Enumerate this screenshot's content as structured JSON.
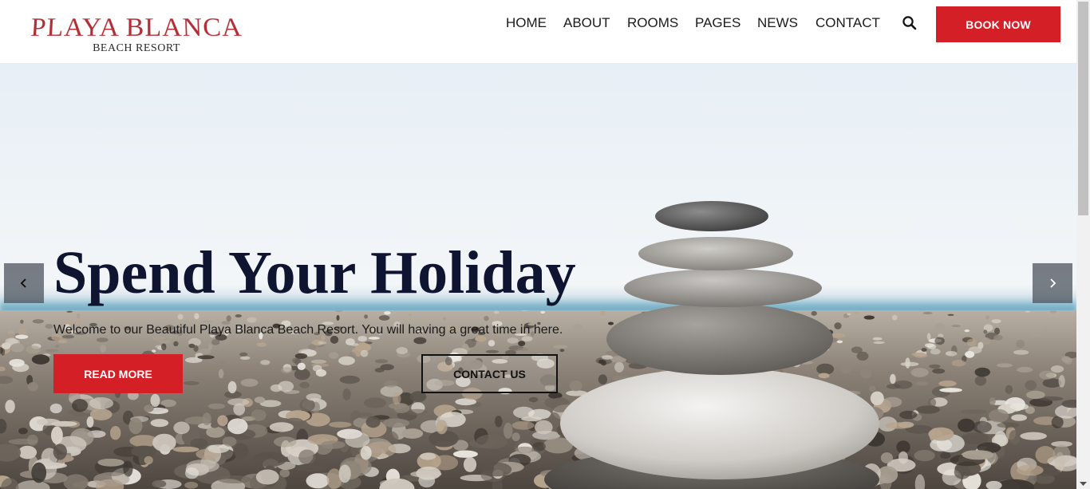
{
  "brand": {
    "name": "PLAYA BLANCA",
    "tagline": "BEACH RESORT",
    "color": "#b32d35"
  },
  "nav": {
    "items": [
      {
        "label": "HOME"
      },
      {
        "label": "ABOUT"
      },
      {
        "label": "ROOMS"
      },
      {
        "label": "PAGES"
      },
      {
        "label": "NEWS"
      },
      {
        "label": "CONTACT"
      }
    ],
    "search_icon": "search-icon",
    "book_label": "BOOK NOW"
  },
  "hero": {
    "title": "Spend Your Holiday",
    "text": "Welcome to our Beautiful Playa Blanca Beach Resort. You will having a great time in here.",
    "read_more_label": "READ MORE",
    "contact_label": "CONTACT US",
    "prev_icon": "chevron-left-icon",
    "next_icon": "chevron-right-icon"
  },
  "colors": {
    "accent": "#d41f26",
    "title": "#0f1530"
  }
}
